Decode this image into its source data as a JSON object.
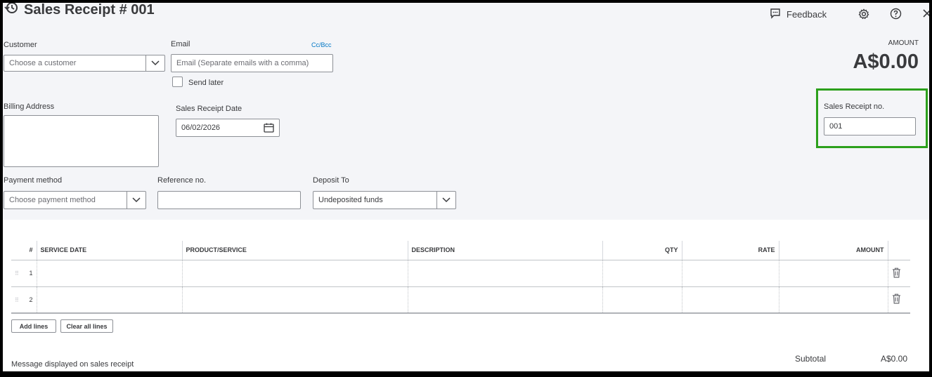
{
  "header": {
    "title": "Sales Receipt # 001",
    "feedback_label": "Feedback"
  },
  "form": {
    "customer": {
      "label": "Customer",
      "placeholder": "Choose a customer"
    },
    "email": {
      "label": "Email",
      "placeholder": "Email (Separate emails with a comma)",
      "cc_bcc": "Cc/Bcc",
      "send_later": "Send later"
    },
    "billing_address": {
      "label": "Billing Address"
    },
    "receipt_date": {
      "label": "Sales Receipt Date",
      "value": "06/02/2026"
    },
    "amount": {
      "label": "AMOUNT",
      "value": "A$0.00"
    },
    "receipt_no": {
      "label": "Sales Receipt no.",
      "value": "001"
    },
    "payment_method": {
      "label": "Payment method",
      "placeholder": "Choose payment method"
    },
    "reference_no": {
      "label": "Reference no."
    },
    "deposit_to": {
      "label": "Deposit To",
      "value": "Undeposited funds"
    }
  },
  "table": {
    "columns": [
      "#",
      "SERVICE DATE",
      "PRODUCT/SERVICE",
      "DESCRIPTION",
      "QTY",
      "RATE",
      "AMOUNT"
    ],
    "rows": [
      {
        "num": "1"
      },
      {
        "num": "2"
      }
    ]
  },
  "actions": {
    "add_lines": "Add lines",
    "clear_all_lines": "Clear all lines"
  },
  "footer": {
    "message_label": "Message displayed on sales receipt",
    "subtotal_label": "Subtotal",
    "subtotal_value": "A$0.00"
  },
  "colors": {
    "highlight": "#2ca01c",
    "link": "#0077c5",
    "panel": "#f4f5f8"
  },
  "icons": [
    "history-icon",
    "feedback-icon",
    "gear-icon",
    "help-icon",
    "close-icon",
    "chevron-down-icon",
    "calendar-icon",
    "drag-handle-icon",
    "trash-icon"
  ]
}
